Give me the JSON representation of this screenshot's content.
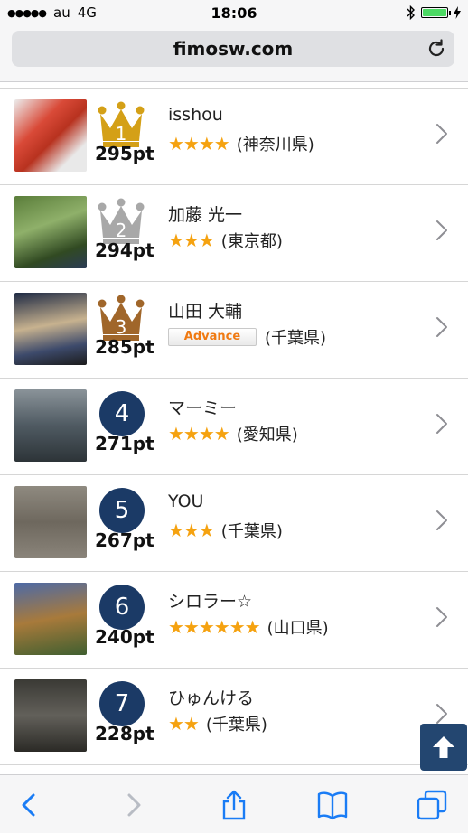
{
  "status_bar": {
    "carrier": "au",
    "network": "4G",
    "time": "18:06",
    "signal_bars": 5,
    "battery_level": 1.0
  },
  "browser": {
    "url": "fimosw.com",
    "icons": [
      "reload-icon",
      "back-icon",
      "forward-icon",
      "share-icon",
      "bookmarks-icon",
      "tabs-icon"
    ]
  },
  "colors": {
    "star": "#f5a210",
    "rank_circle": "#1b3a66",
    "gold": "#d4a017",
    "silver": "#a8a8a8",
    "bronze": "#a0662a",
    "advance_badge": "#f07a12"
  },
  "ranking": [
    {
      "rank": "1",
      "rank_style": "gold-crown",
      "points": "295pt",
      "name": "isshou",
      "stars": "★★★★",
      "badge": "",
      "prefecture": "(神奈川県)"
    },
    {
      "rank": "2",
      "rank_style": "silver-crown",
      "points": "294pt",
      "name": "加藤 光一",
      "stars": "★★★",
      "badge": "",
      "prefecture": "(東京都)"
    },
    {
      "rank": "3",
      "rank_style": "bronze-crown",
      "points": "285pt",
      "name": "山田 大輔",
      "stars": "",
      "badge": "Advance",
      "prefecture": "(千葉県)"
    },
    {
      "rank": "4",
      "rank_style": "circle",
      "points": "271pt",
      "name": "マーミー",
      "stars": "★★★★",
      "badge": "",
      "prefecture": "(愛知県)"
    },
    {
      "rank": "5",
      "rank_style": "circle",
      "points": "267pt",
      "name": "YOU",
      "stars": "★★★",
      "badge": "",
      "prefecture": "(千葉県)"
    },
    {
      "rank": "6",
      "rank_style": "circle",
      "points": "240pt",
      "name": "シロラー☆",
      "stars": "★★★★★★",
      "badge": "",
      "prefecture": "(山口県)"
    },
    {
      "rank": "7",
      "rank_style": "circle",
      "points": "228pt",
      "name": "ひゅんける",
      "stars": "★★",
      "badge": "",
      "prefecture": "(千葉県)"
    }
  ],
  "scroll_top_icon": "arrow-up-icon"
}
